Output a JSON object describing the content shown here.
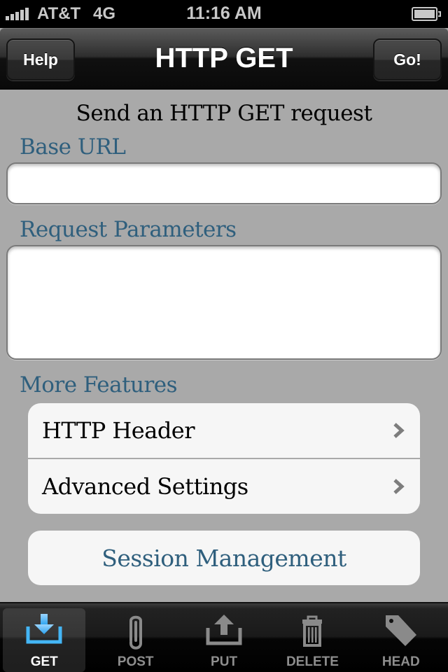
{
  "status_bar": {
    "carrier": "AT&T",
    "network": "4G",
    "time": "11:16 AM",
    "signal_bars": 5,
    "battery_icon": "battery-full-icon"
  },
  "nav_bar": {
    "title": "HTTP GET",
    "left_button": "Help",
    "right_button": "Go!"
  },
  "form": {
    "subtitle": "Send an HTTP GET request",
    "base_url": {
      "label": "Base URL",
      "value": "",
      "placeholder": ""
    },
    "request_parameters": {
      "label": "Request Parameters",
      "value": "",
      "placeholder": ""
    }
  },
  "more_features": {
    "label": "More Features",
    "items": [
      {
        "label": "HTTP Header",
        "icon": "chevron-right-icon"
      },
      {
        "label": "Advanced Settings",
        "icon": "chevron-right-icon"
      }
    ],
    "session_button": "Session Management"
  },
  "tab_bar": {
    "selected": "GET",
    "tabs": [
      {
        "label": "GET",
        "icon": "download-tray-icon",
        "active": true
      },
      {
        "label": "POST",
        "icon": "paperclip-icon",
        "active": false
      },
      {
        "label": "PUT",
        "icon": "upload-tray-icon",
        "active": false
      },
      {
        "label": "DELETE",
        "icon": "trash-icon",
        "active": false
      },
      {
        "label": "HEAD",
        "icon": "tag-icon",
        "active": false
      }
    ]
  },
  "colors": {
    "accent_text": "#2f5f7d",
    "active_tab_icon": "#4fb3f0",
    "background": "#a9a9a9",
    "inactive_tab": "#8e8e8e"
  }
}
